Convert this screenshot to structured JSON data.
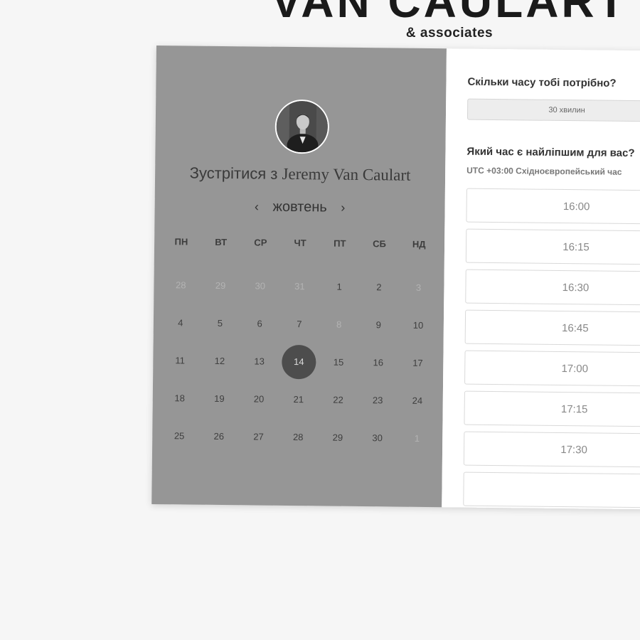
{
  "brand": {
    "title": "VAN CAULART",
    "subtitle": "& associates"
  },
  "calendar": {
    "meet_prefix": "Зустрітися з",
    "host_name": "Jeremy Van Caulart",
    "month": "жовтень",
    "prev_arrow": "‹",
    "next_arrow": "›",
    "weekdays": [
      "ПН",
      "ВТ",
      "СР",
      "ЧТ",
      "ПТ",
      "СБ",
      "НД"
    ],
    "days": [
      {
        "label": "28",
        "muted": true
      },
      {
        "label": "29",
        "muted": true
      },
      {
        "label": "30",
        "muted": true
      },
      {
        "label": "31",
        "muted": true
      },
      {
        "label": "1"
      },
      {
        "label": "2"
      },
      {
        "label": "3",
        "muted": true
      },
      {
        "label": "4"
      },
      {
        "label": "5"
      },
      {
        "label": "6"
      },
      {
        "label": "7"
      },
      {
        "label": "8",
        "muted": true
      },
      {
        "label": "9"
      },
      {
        "label": "10"
      },
      {
        "label": "11"
      },
      {
        "label": "12"
      },
      {
        "label": "13"
      },
      {
        "label": "14",
        "selected": true
      },
      {
        "label": "15"
      },
      {
        "label": "16"
      },
      {
        "label": "17"
      },
      {
        "label": "18"
      },
      {
        "label": "19"
      },
      {
        "label": "20"
      },
      {
        "label": "21"
      },
      {
        "label": "22"
      },
      {
        "label": "23"
      },
      {
        "label": "24"
      },
      {
        "label": "25"
      },
      {
        "label": "26"
      },
      {
        "label": "27"
      },
      {
        "label": "28"
      },
      {
        "label": "29"
      },
      {
        "label": "30"
      },
      {
        "label": "1",
        "muted": true
      }
    ]
  },
  "booking": {
    "duration_question": "Скільки часу тобі потрібно?",
    "duration_value": "30 хвилин",
    "time_question": "Який час є найліпшим для вас?",
    "timezone_offset": "UTC +03:00",
    "timezone_name": "Східноєвропейський час",
    "slots": [
      "16:00",
      "16:15",
      "16:30",
      "16:45",
      "17:00",
      "17:15",
      "17:30",
      ""
    ]
  },
  "colors": {
    "page_bg": "#f6f6f6",
    "calendar_bg": "#969696",
    "selected_day": "#4d4d4d",
    "panel_bg": "#ffffff"
  },
  "icons": {
    "avatar": "profile-photo",
    "prev": "chevron-left-icon",
    "next": "chevron-right-icon"
  }
}
